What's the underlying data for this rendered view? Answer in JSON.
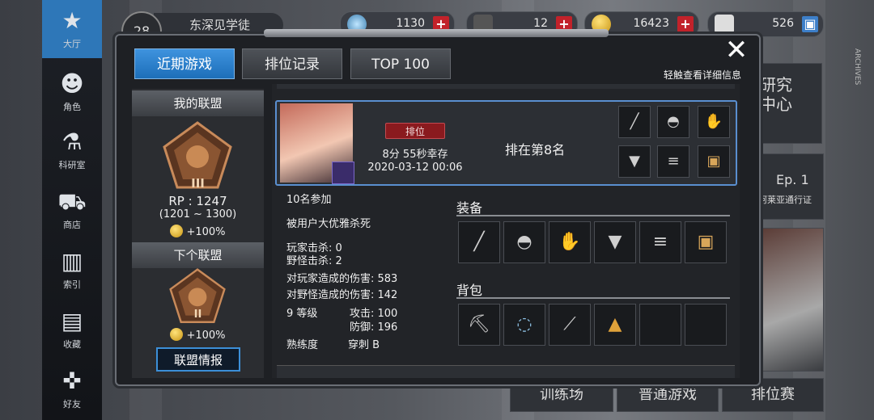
{
  "header": {
    "level": "28",
    "username": "东深见学徒",
    "resources": [
      {
        "name": "gem",
        "value": "1130"
      },
      {
        "name": "ticket",
        "value": "12"
      },
      {
        "name": "gold",
        "value": "16423"
      },
      {
        "name": "bp",
        "value": "526"
      }
    ]
  },
  "sidebar": {
    "items": [
      {
        "label": "大厅",
        "icon": "lobby-icon"
      },
      {
        "label": "角色",
        "icon": "character-icon"
      },
      {
        "label": "科研室",
        "icon": "flask-icon"
      },
      {
        "label": "商店",
        "icon": "cart-icon"
      },
      {
        "label": "索引",
        "icon": "books-icon"
      },
      {
        "label": "收藏",
        "icon": "book-open-icon"
      },
      {
        "label": "好友",
        "icon": "gamepad-icon"
      }
    ]
  },
  "background": {
    "research_center": "研究\n中心",
    "ep": "Ep. 1",
    "pass": "阿莱亚通行证",
    "training": "训练场",
    "normal_game": "普通游戏",
    "ranked": "排位赛",
    "side_text": "ARCHIVES"
  },
  "dialog": {
    "tabs": [
      "近期游戏",
      "排位记录",
      "TOP 100"
    ],
    "hint": "轻触查看详细信息"
  },
  "league": {
    "my_league_title": "我的联盟",
    "rp": "RP : 1247",
    "rp_range": "(1201 ~ 1300)",
    "bonus": "+100%",
    "current_tier": "III",
    "next_league_title": "下个联盟",
    "next_tier": "II",
    "next_bonus": "+100%",
    "info_button": "联盟情报"
  },
  "game": {
    "mode_badge": "排位",
    "survival": "8分 55秒幸存",
    "datetime": "2020-03-12 00:06",
    "rank_text": "排在第8名",
    "participants": "10名参加",
    "killed_by": "被用户大优雅杀死",
    "player_kills": "玩家击杀: 0",
    "monster_kills": "野怪击杀: 2",
    "player_damage": "对玩家造成的伤害: 583",
    "monster_damage": "对野怪造成的伤害: 142",
    "level": "9 等级",
    "attack": "攻击: 100",
    "defense": "防御: 196",
    "mastery_label": "熟练度",
    "mastery_value": "穿刺 B",
    "equipment_title": "装备",
    "bag_title": "背包",
    "equipment": [
      "spear-icon",
      "helmet-icon",
      "gloves-icon",
      "armor-icon",
      "arm-guard-icon",
      "crate-icon"
    ],
    "bag": [
      "pickaxe-icon",
      "chain-icon",
      "blade-icon",
      "powder-icon",
      "",
      ""
    ]
  }
}
